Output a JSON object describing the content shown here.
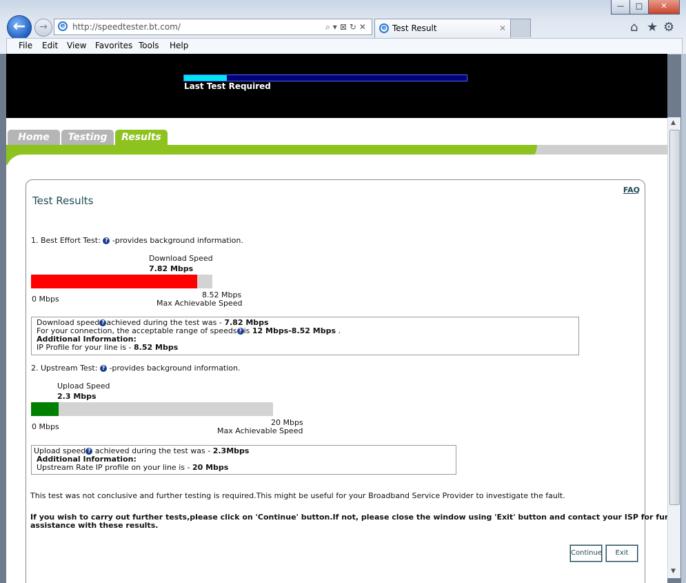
{
  "browser": {
    "url": "http://speedtester.bt.com/",
    "tab_title": "Test Result",
    "tab_close": "✕",
    "menu": [
      "File",
      "Edit",
      "View",
      "Favorites",
      "Tools",
      "Help"
    ],
    "window_controls": [
      "—",
      "□",
      "✕"
    ]
  },
  "banner": {
    "progress_fraction": 0.15,
    "status": "Last Test Required"
  },
  "nav": {
    "tabs": [
      "Home",
      "Testing",
      "Results"
    ],
    "active": "Results"
  },
  "results": {
    "title": "Test Results",
    "faq": "FAQ",
    "best_effort": {
      "heading": "1. Best Effort Test:",
      "heading_suffix": "-provides background information.",
      "bar_label": "Download Speed",
      "speed": "7.82 Mbps",
      "fill_fraction": 0.918,
      "min_label": "0 Mbps",
      "max_value": "8.52 Mbps",
      "max_label": "Max Achievable Speed",
      "info": {
        "line1_a": "Download speed",
        "line1_b": "achieved during the test was - ",
        "line1_val": "7.82 Mbps",
        "line2_a": "For your connection, the acceptable range of speeds",
        "line2_b": "is ",
        "line2_val": "12 Mbps-8.52 Mbps",
        "line2_end": " .",
        "additional": "Additional Information:",
        "line4_a": "IP Profile for your line is - ",
        "line4_val": "8.52 Mbps"
      }
    },
    "upstream": {
      "heading": "2. Upstream Test:",
      "heading_suffix": "-provides background information.",
      "bar_label": "Upload Speed",
      "speed": "2.3 Mbps",
      "fill_fraction": 0.115,
      "min_label": "0 Mbps",
      "max_value": "20 Mbps",
      "max_label": "Max Achievable Speed",
      "info": {
        "line1_a": "Upload speed",
        "line1_b": " achieved during the test was - ",
        "line1_val": "2.3Mbps",
        "additional": "Additional Information:",
        "line3_a": "Upstream Rate IP profile on your line is - ",
        "line3_val": "20 Mbps"
      }
    },
    "conclusion": "This test was not conclusive and further testing is required.This might be useful for your Broadband Service Provider to investigate the fault.",
    "instruction_1": "If you wish to carry out further tests,please click on 'Continue' button.If not, please close the window using 'Exit' button and contact your ISP for further",
    "instruction_2": "assistance with these results.",
    "continue_label": "Continue",
    "exit_label": "Exit"
  },
  "colors": {
    "download_fill": "#ff0000",
    "upload_fill": "#008000",
    "nav_green": "#8dc21f",
    "nav_grey": "#b5b5b5"
  }
}
